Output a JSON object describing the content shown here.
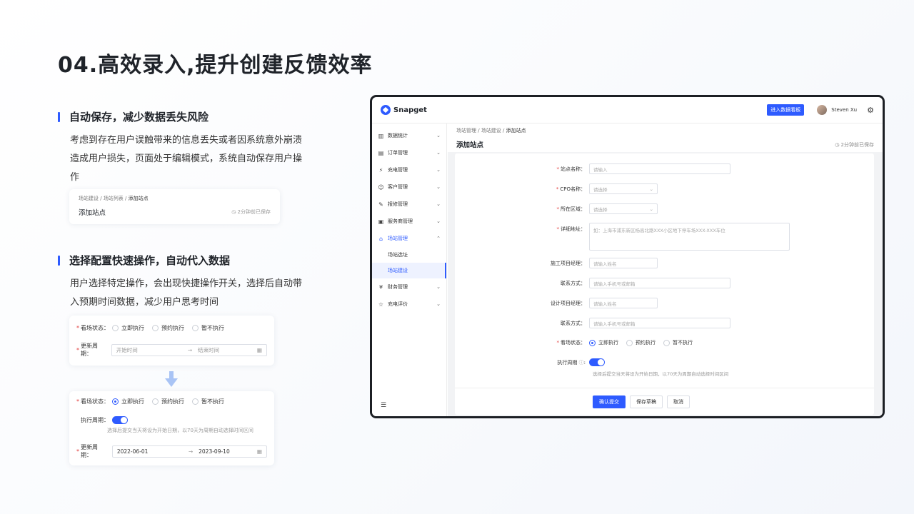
{
  "page": {
    "title": "04.高效录入,提升创建反馈效率"
  },
  "features": [
    {
      "title": "自动保存，减少数据丢失风险",
      "desc": "考虑到存在用户误触带来的信息丢失或者因系统意外崩溃造成用户损失，页面处于编辑模式，系统自动保存用户操作"
    },
    {
      "title": "选择配置快速操作，自动代入数据",
      "desc": "用户选择特定操作，会出现快捷操作开关，选择后自动带入预期时间数据，减少用户思考时间"
    }
  ],
  "card1": {
    "crumbs": [
      "场站建设",
      "场站列表",
      "添加站点"
    ],
    "title": "添加站点",
    "saved": "2分钟前已保存"
  },
  "card2": {
    "status_label": "看场状态：",
    "options": [
      "立即执行",
      "预约执行",
      "暂不执行"
    ],
    "period_label": "更新周期：",
    "start_placeholder": "开始时间",
    "end_placeholder": "结束时间"
  },
  "card3": {
    "status_label": "看场状态：",
    "options": [
      "立即执行",
      "预约执行",
      "暂不执行"
    ],
    "exec_label": "执行周期：",
    "hint": "选择后提交当天将设为开始日期，以70天为周期自动选择时间区间",
    "period_label": "更新周期：",
    "start": "2022-06-01",
    "end": "2023-09-10"
  },
  "app": {
    "brand": "Snapget",
    "dashboard_button": "进入数据看板",
    "user": "Steven Xu",
    "menu": [
      {
        "label": "数据统计",
        "icon": "chart-icon"
      },
      {
        "label": "订单管理",
        "icon": "order-icon"
      },
      {
        "label": "充电管理",
        "icon": "charge-icon"
      },
      {
        "label": "客户管理",
        "icon": "customer-icon"
      },
      {
        "label": "报修管理",
        "icon": "repair-icon"
      },
      {
        "label": "服务商管理",
        "icon": "provider-icon"
      },
      {
        "label": "场站管理",
        "icon": "station-icon"
      },
      {
        "label": "财务管理",
        "icon": "finance-icon"
      },
      {
        "label": "充电评价",
        "icon": "review-icon"
      }
    ],
    "submenu": [
      "场站选址",
      "场站建设"
    ],
    "crumbs": [
      "场站管理",
      "场站建设",
      "添加站点"
    ],
    "content_title": "添加站点",
    "saved": "2分钟前已保存",
    "form": {
      "name_label": "站点名称：",
      "name_ph": "请输入",
      "cpo_label": "CPO名称：",
      "cpo_ph": "请选择",
      "area_label": "所在区域：",
      "area_ph": "请选择",
      "addr_label": "详细地址：",
      "addr_ph": "如：上海市浦东新区杨高北路XXX小区地下停车场XXX-XXX车位",
      "pm_label": "施工项目经理：",
      "pm_ph": "请输入姓名",
      "contact_label": "联系方式：",
      "contact_ph": "请输入手机号或邮箱",
      "dm_label": "设计项目经理：",
      "dm_ph": "请输入姓名",
      "contact2_label": "联系方式：",
      "contact2_ph": "请输入手机号或邮箱",
      "status_label": "看场状态：",
      "options": [
        "立即执行",
        "预约执行",
        "暂不执行"
      ],
      "exec_label": "执行周期",
      "hint": "选择后提交当天将设为开始日期，以70天为周期自动选择时间区间"
    },
    "buttons": {
      "submit": "确认提交",
      "draft": "保存草稿",
      "cancel": "取消"
    }
  }
}
